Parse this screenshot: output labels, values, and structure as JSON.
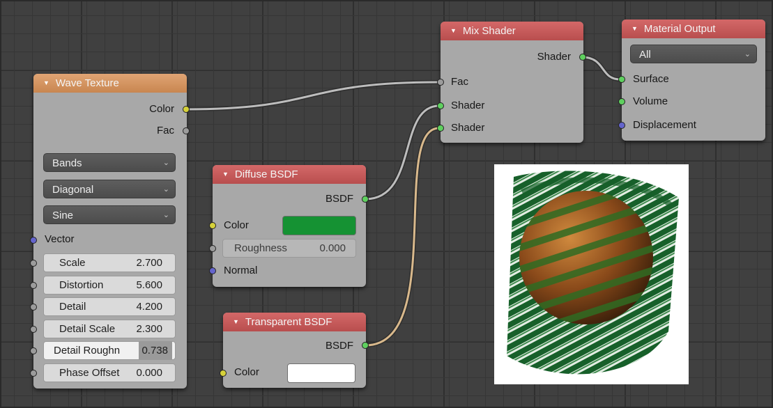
{
  "editor": {
    "name": "Node Editor"
  },
  "wave_texture": {
    "title": "Wave Texture",
    "outputs": {
      "color": "Color",
      "fac": "Fac"
    },
    "dropdowns": {
      "type": "Bands",
      "direction": "Diagonal",
      "profile": "Sine"
    },
    "vector_label": "Vector",
    "fields": [
      {
        "label": "Scale",
        "value": "2.700"
      },
      {
        "label": "Distortion",
        "value": "5.600"
      },
      {
        "label": "Detail",
        "value": "4.200"
      },
      {
        "label": "Detail Scale",
        "value": "2.300"
      },
      {
        "label": "Detail Roughn",
        "value": "0.738"
      },
      {
        "label": "Phase Offset",
        "value": "0.000"
      }
    ]
  },
  "diffuse_bsdf": {
    "title": "Diffuse BSDF",
    "output": "BSDF",
    "color_label": "Color",
    "color_value": "#159233",
    "roughness_label": "Roughness",
    "roughness_value": "0.000",
    "normal_label": "Normal"
  },
  "transparent_bsdf": {
    "title": "Transparent BSDF",
    "output": "BSDF",
    "color_label": "Color",
    "color_value": "#ffffff"
  },
  "mix_shader": {
    "title": "Mix Shader",
    "output": "Shader",
    "inputs": {
      "fac": "Fac",
      "shader1": "Shader",
      "shader2": "Shader"
    }
  },
  "material_output": {
    "title": "Material Output",
    "target": "All",
    "inputs": {
      "surface": "Surface",
      "volume": "Volume",
      "displacement": "Displacement"
    }
  },
  "colors": {
    "header_shader": "#c45656",
    "header_texture": "#d6945e",
    "node_body": "#a8a8a8",
    "socket_shader": "#5fd05f",
    "socket_color": "#d6d13a",
    "socket_value": "#9c9c9c",
    "socket_vector": "#6464cc"
  }
}
